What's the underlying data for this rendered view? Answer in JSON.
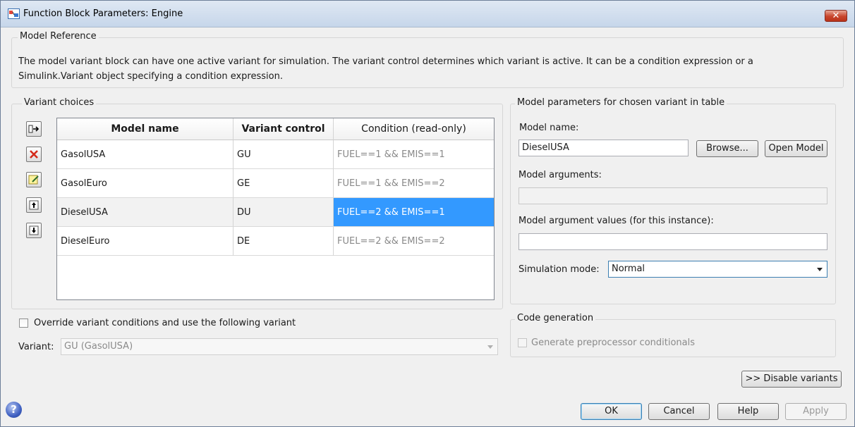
{
  "window": {
    "title": "Function Block Parameters: Engine",
    "close_glyph": "✕"
  },
  "model_reference": {
    "label": "Model Reference",
    "description_line1": "The model variant block can have one active variant for simulation. The variant control determines which variant is active. It can be a condition expression or a",
    "description_line2": "Simulink.Variant object specifying a condition expression."
  },
  "variant_choices": {
    "label": "Variant choices",
    "toolbar_icons": [
      "add-variant-icon",
      "delete-variant-icon",
      "edit-variant-icon",
      "move-up-icon",
      "move-down-icon"
    ],
    "columns": [
      "Model name",
      "Variant control",
      "Condition (read-only)"
    ],
    "rows": [
      {
        "model": "GasolUSA",
        "control": "GU",
        "condition": "FUEL==1 && EMIS==1",
        "selected": false
      },
      {
        "model": "GasolEuro",
        "control": "GE",
        "condition": "FUEL==1 && EMIS==2",
        "selected": false
      },
      {
        "model": "DieselUSA",
        "control": "DU",
        "condition": "FUEL==2 && EMIS==1",
        "selected": true
      },
      {
        "model": "DieselEuro",
        "control": "DE",
        "condition": "FUEL==2 && EMIS==2",
        "selected": false
      }
    ]
  },
  "override": {
    "checkbox_label": "Override variant conditions and use the following variant",
    "checked": false,
    "variant_label": "Variant:",
    "variant_value": "GU (GasolUSA)"
  },
  "model_params": {
    "label": "Model parameters for chosen variant in table",
    "model_name_label": "Model name:",
    "model_name_value": "DieselUSA",
    "browse_label": "Browse...",
    "open_model_label": "Open Model",
    "model_args_label": "Model arguments:",
    "model_args_value": "",
    "model_arg_values_label": "Model argument values (for this instance):",
    "model_arg_values_value": "",
    "sim_mode_label": "Simulation mode:",
    "sim_mode_value": "Normal"
  },
  "code_generation": {
    "label": "Code generation",
    "preprocessor_label": "Generate preprocessor conditionals",
    "checked": false
  },
  "footer": {
    "disable_variants": ">> Disable variants",
    "ok": "OK",
    "cancel": "Cancel",
    "help": "Help",
    "apply": "Apply",
    "help_glyph": "?"
  },
  "colors": {
    "selection": "#3399ff",
    "close_button": "#c8452d",
    "condition_text": "#8a8a8a"
  }
}
